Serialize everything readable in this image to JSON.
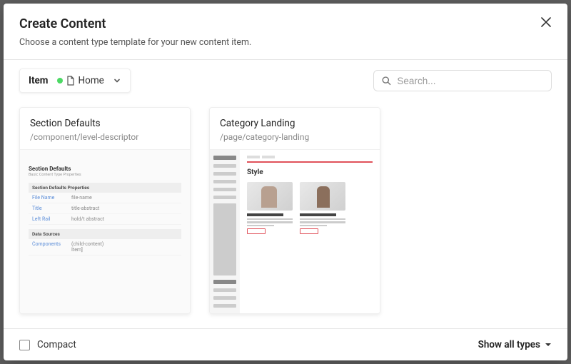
{
  "modal": {
    "title": "Create Content",
    "subtitle": "Choose a content type template for your new content item."
  },
  "location": {
    "label": "Item",
    "value": "Home"
  },
  "search": {
    "placeholder": "Search..."
  },
  "cards": [
    {
      "title": "Section Defaults",
      "path": "/component/level-descriptor"
    },
    {
      "title": "Category Landing",
      "path": "/page/category-landing"
    }
  ],
  "thumb1": {
    "heading": "Section Defaults",
    "sub": "Basic Content Type Properties",
    "section1": "Section Defaults Properties",
    "rows": [
      [
        "File Name",
        "file-name",
        ""
      ],
      [
        "Title",
        "title-abstract",
        ""
      ],
      [
        "Left Rail",
        "hold/t abstract",
        ""
      ]
    ],
    "section2": "Data Sources",
    "rows2": [
      [
        "Components",
        "(child-content) Item]",
        ""
      ]
    ]
  },
  "thumb2": {
    "title": "Style"
  },
  "footer": {
    "compact": "Compact",
    "showall": "Show all types"
  }
}
